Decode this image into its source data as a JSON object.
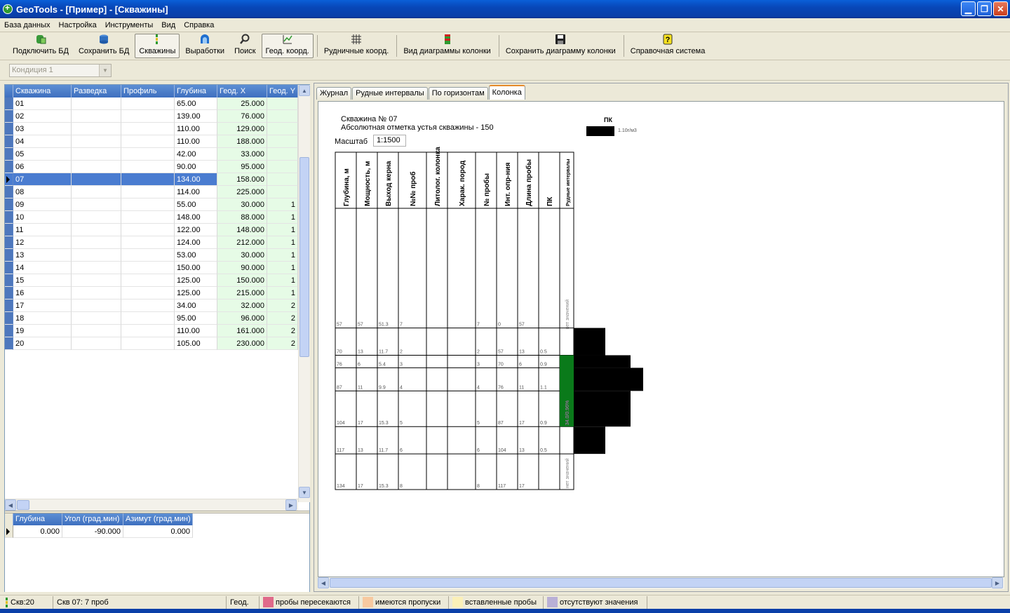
{
  "window": {
    "title": "GeoTools - [Пример] - [Скважины]"
  },
  "menu": [
    {
      "label": "База данных",
      "u": "Б"
    },
    {
      "label": "Настройка",
      "u": "Н"
    },
    {
      "label": "Инструменты",
      "u": "И"
    },
    {
      "label": "Вид",
      "u": ""
    },
    {
      "label": "Справка",
      "u": "С"
    }
  ],
  "toolbar": {
    "connect_db": "Подключить БД",
    "save_db": "Сохранить БД",
    "wells": "Скважины",
    "workings": "Выработки",
    "search": "Поиск",
    "geo_coords": "Геод. коорд.",
    "mine_coords": "Рудничные коорд.",
    "column_view": "Вид диаграммы колонки",
    "save_column": "Сохранить диаграмму колонки",
    "help": "Справочная система"
  },
  "condition": {
    "value": "Кондиция 1"
  },
  "wells_grid": {
    "columns": [
      "Скважина",
      "Разведка",
      "Профиль",
      "Глубина",
      "Геод. X",
      "Геод. Y"
    ],
    "rows": [
      {
        "well": "01",
        "depth": "65.00",
        "x": "25.000",
        "y": ""
      },
      {
        "well": "02",
        "depth": "139.00",
        "x": "76.000",
        "y": ""
      },
      {
        "well": "03",
        "depth": "110.00",
        "x": "129.000",
        "y": ""
      },
      {
        "well": "04",
        "depth": "110.00",
        "x": "188.000",
        "y": ""
      },
      {
        "well": "05",
        "depth": "42.00",
        "x": "33.000",
        "y": ""
      },
      {
        "well": "06",
        "depth": "90.00",
        "x": "95.000",
        "y": ""
      },
      {
        "well": "07",
        "depth": "134.00",
        "x": "158.000",
        "y": ""
      },
      {
        "well": "08",
        "depth": "114.00",
        "x": "225.000",
        "y": ""
      },
      {
        "well": "09",
        "depth": "55.00",
        "x": "30.000",
        "y": "1"
      },
      {
        "well": "10",
        "depth": "148.00",
        "x": "88.000",
        "y": "1"
      },
      {
        "well": "11",
        "depth": "122.00",
        "x": "148.000",
        "y": "1"
      },
      {
        "well": "12",
        "depth": "124.00",
        "x": "212.000",
        "y": "1"
      },
      {
        "well": "13",
        "depth": "53.00",
        "x": "30.000",
        "y": "1"
      },
      {
        "well": "14",
        "depth": "150.00",
        "x": "90.000",
        "y": "1"
      },
      {
        "well": "15",
        "depth": "125.00",
        "x": "150.000",
        "y": "1"
      },
      {
        "well": "16",
        "depth": "125.00",
        "x": "215.000",
        "y": "1"
      },
      {
        "well": "17",
        "depth": "34.00",
        "x": "32.000",
        "y": "2"
      },
      {
        "well": "18",
        "depth": "95.00",
        "x": "96.000",
        "y": "2"
      },
      {
        "well": "19",
        "depth": "110.00",
        "x": "161.000",
        "y": "2"
      },
      {
        "well": "20",
        "depth": "105.00",
        "x": "230.000",
        "y": "2"
      }
    ],
    "selected_index": 6
  },
  "inclination_grid": {
    "columns": [
      "Глубина",
      "Угол (град.мин)",
      "Азимут (град.мин)"
    ],
    "rows": [
      {
        "depth": "0.000",
        "angle": "-90.000",
        "azimuth": "0.000"
      }
    ]
  },
  "tabs": [
    "Журнал",
    "Рудные интервалы",
    "По горизонтам",
    "Колонка"
  ],
  "active_tab": 3,
  "column_chart": {
    "well_title": "Скважина № 07",
    "collar_elevation": "Абсолютная отметка устья скважины - 150",
    "scale_label": "Масштаб",
    "scale_value": "1:1500",
    "pk_legend_label": "ПК",
    "pk_legend_value": "1.10г/м3",
    "headers": [
      "Глубина, м",
      "Мощность, м",
      "Выход керна",
      "№№ проб",
      "Литолог. колонка",
      "Харак. пород",
      "№ пробы",
      "Инт. опр-ния",
      "Длина пробы",
      "ПК",
      "Рудные интервалы"
    ],
    "intervals": [
      {
        "depth": "57",
        "thick": "57",
        "core": "51.3",
        "sample_no": "7",
        "sample": "7",
        "interval": "0",
        "length": "57",
        "pk": ""
      },
      {
        "depth": "70",
        "thick": "13",
        "core": "11.7",
        "sample_no": "2",
        "sample": "2",
        "interval": "57",
        "length": "13",
        "pk": "0.5"
      },
      {
        "depth": "76",
        "thick": "6",
        "core": "5.4",
        "sample_no": "3",
        "sample": "3",
        "interval": "70",
        "length": "6",
        "pk": "0.9"
      },
      {
        "depth": "87",
        "thick": "11",
        "core": "9.9",
        "sample_no": "4",
        "sample": "4",
        "interval": "76",
        "length": "11",
        "pk": "1.1"
      },
      {
        "depth": "104",
        "thick": "17",
        "core": "15.3",
        "sample_no": "5",
        "sample": "5",
        "interval": "87",
        "length": "17",
        "pk": "0.9"
      },
      {
        "depth": "117",
        "thick": "13",
        "core": "11.7",
        "sample_no": "6",
        "sample": "6",
        "interval": "104",
        "length": "13",
        "pk": "0.5"
      },
      {
        "depth": "134",
        "thick": "17",
        "core": "15.3",
        "sample_no": "8",
        "sample": "8",
        "interval": "117",
        "length": "17",
        "pk": ""
      }
    ],
    "ore_label_none": "нет значений",
    "ore_label_value": "34.0/0.96%",
    "ore_color": "#0a7a1a",
    "bar_color": "#000000"
  },
  "status": {
    "wells_count": "Скв:20",
    "well_samples": "Скв 07: 7 проб",
    "mode": "Геод.",
    "legend": [
      {
        "label": "пробы пересекаются",
        "color": "#e06a8a"
      },
      {
        "label": "имеются пропуски",
        "color": "#f7c9a0"
      },
      {
        "label": "вставленные пробы",
        "color": "#fbf0b8"
      },
      {
        "label": "отсутствуют значения",
        "color": "#b9b0d6"
      }
    ]
  }
}
